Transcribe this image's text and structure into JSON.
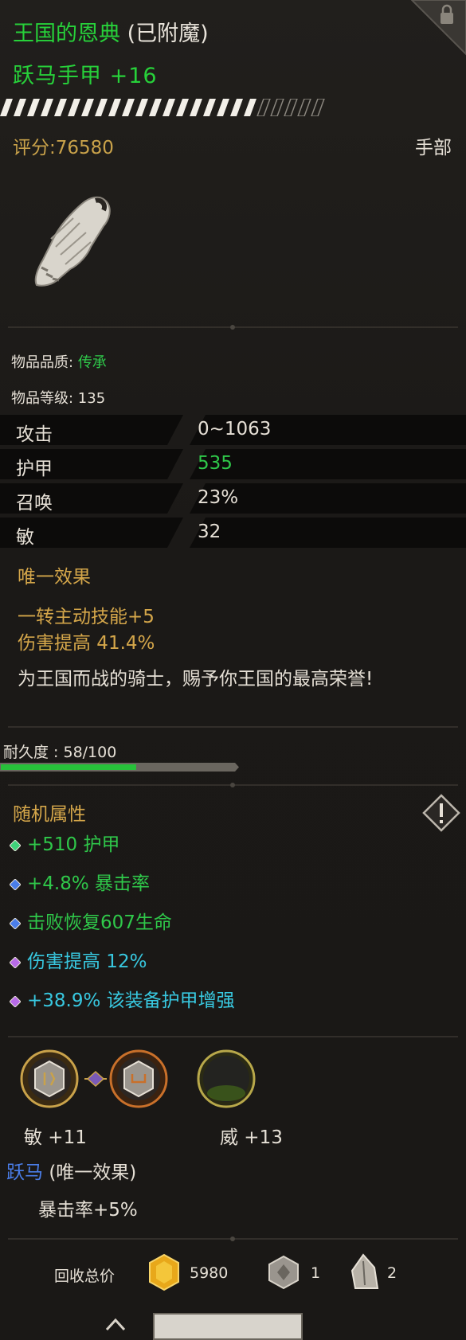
{
  "item": {
    "prefix": "王国的恩典",
    "prefix_suffix": "(已附魔)",
    "name": "跃马手甲 +16",
    "score_label": "评分:76580",
    "slot": "手部",
    "quality_label": "物品品质:",
    "quality_value": "传承",
    "level_label": "物品等级: 135"
  },
  "stats": [
    {
      "name": "攻击",
      "value": "0~1063",
      "value_color": "#e6e0d6"
    },
    {
      "name": "护甲",
      "value": "535",
      "value_color": "#2fc84a"
    },
    {
      "name": "召唤",
      "value": "23%",
      "value_color": "#e6e0d6"
    },
    {
      "name": "敏",
      "value": "32",
      "value_color": "#e6e0d6"
    }
  ],
  "unique": {
    "header": "唯一效果",
    "lines": [
      "一转主动技能+5",
      "伤害提高 41.4%"
    ],
    "flavor": "为王国而战的骑士，赐予你王国的最高荣誉!"
  },
  "durability": {
    "label": "耐久度 : 58/100",
    "current": 58,
    "max": 100
  },
  "random_attrs": {
    "header": "随机属性",
    "items": [
      {
        "text": "+510 护甲",
        "color": "#2fc84a",
        "gem": "#3fd17a"
      },
      {
        "text": "+4.8% 暴击率",
        "color": "#2fc84a",
        "gem": "#4a7de8"
      },
      {
        "text": "击败恢复607生命",
        "color": "#2fc84a",
        "gem": "#4a7de8"
      },
      {
        "text": "伤害提高 12%",
        "color": "#38c8e0",
        "gem": "#b86ae8"
      },
      {
        "text": "+38.9% 该装备护甲增强",
        "color": "#38c8e0",
        "gem": "#b86ae8"
      }
    ]
  },
  "sockets": {
    "left_label": "敏 +11",
    "right_label": "威 +13"
  },
  "set": {
    "name": "跃马",
    "suffix": "(唯一效果)",
    "bonus": "暴击率+5%"
  },
  "recycle": {
    "label": "回收总价",
    "gold": "5980",
    "stone": "1",
    "shard": "2"
  },
  "colors": {
    "green": "#2fc84a",
    "gold": "#d4a64a",
    "cyan": "#38c8e0",
    "blue": "#4a7de8"
  }
}
